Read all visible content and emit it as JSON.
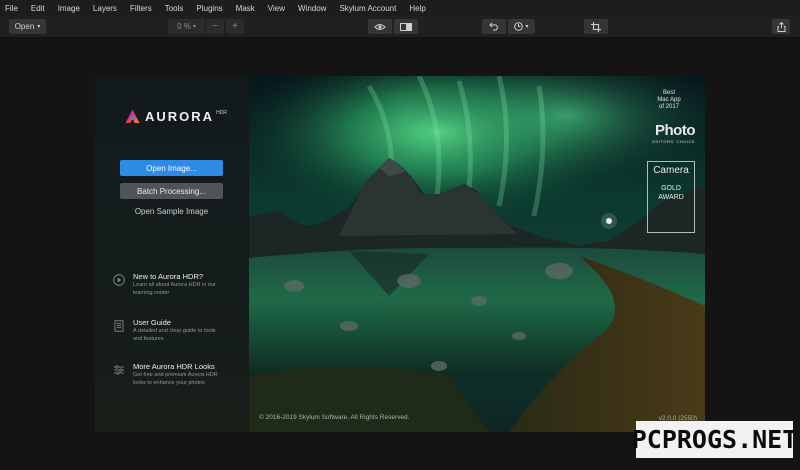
{
  "menu": [
    "File",
    "Edit",
    "Image",
    "Layers",
    "Filters",
    "Tools",
    "Plugins",
    "Mask",
    "View",
    "Window",
    "Skylum Account",
    "Help"
  ],
  "toolbar": {
    "open_label": "Open",
    "open_chevron": "▾",
    "zoom_value": "0 %",
    "zoom_chevron": "▾",
    "zoom_out": "−",
    "zoom_in": "+",
    "history_chevron": "▾"
  },
  "welcome": {
    "logo_name": "AURORA",
    "logo_suffix": "HDR",
    "open_image_button": "Open Image...",
    "batch_button": "Batch Processing...",
    "sample_link": "Open Sample Image",
    "help_items": [
      {
        "icon": "play-circle-icon",
        "title": "New to Aurora HDR?",
        "desc": "Learn all about Aurora HDR in our learning center"
      },
      {
        "icon": "document-icon",
        "title": "User Guide",
        "desc": "A detailed and clear guide to tools and features"
      },
      {
        "icon": "sliders-icon",
        "title": "More Aurora HDR Looks",
        "desc": "Get free and premium Aurora HDR looks to enhance your photos"
      }
    ]
  },
  "awards": {
    "mac_app_line1": "Best",
    "mac_app_line2": "Mac App",
    "mac_app_line3": "of 2017",
    "photo_title": "Photo",
    "photo_sub": "EDITORS' CHOICE",
    "camera_title": "Camera",
    "camera_line1": "GOLD",
    "camera_line2": "AWARD"
  },
  "footer": {
    "copyright": "© 2016-2019 Skylum Software. All Rights Reserved.",
    "version": "v2.0.0 (2550)"
  },
  "watermark": "PCPROGS.NET",
  "colors": {
    "accent": "#2d8be6",
    "menubar": "#1d1d1d",
    "toolbar": "#202020",
    "background": "#141414"
  }
}
